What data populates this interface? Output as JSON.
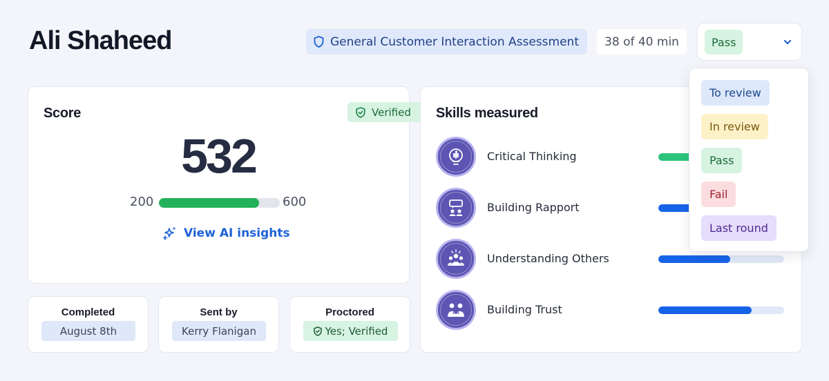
{
  "candidate": {
    "name": "Ali Shaheed"
  },
  "header": {
    "assessment_name": "General Customer Interaction Assessment",
    "assessment_icon": "shield-icon",
    "time_used": "38 of 40 min",
    "status_value": "Pass",
    "status_chevron_icon": "chevron-down-icon"
  },
  "status_menu": {
    "options": [
      {
        "label": "To review",
        "bg": "#dde8fb",
        "fg": "#1e4a8f"
      },
      {
        "label": "In review",
        "bg": "#fdf1c8",
        "fg": "#7a5a0c"
      },
      {
        "label": "Pass",
        "bg": "#d6f4e1",
        "fg": "#1e6a3b"
      },
      {
        "label": "Fail",
        "bg": "#fbdde0",
        "fg": "#9d2431"
      },
      {
        "label": "Last round",
        "bg": "#e6dcfb",
        "fg": "#4d2a91"
      }
    ]
  },
  "score_card": {
    "title": "Score",
    "verified_label": "Verified",
    "score": "532",
    "range_min": "200",
    "range_max": "600",
    "score_fraction": 0.83,
    "ai_insights_label": "View AI insights"
  },
  "info_cards": {
    "completed": {
      "label": "Completed",
      "value": "August 8th"
    },
    "sent_by": {
      "label": "Sent by",
      "value": "Kerry Flanigan"
    },
    "proctored": {
      "label": "Proctored",
      "value": "Yes; Verified"
    }
  },
  "skills": {
    "title": "Skills measured",
    "items": [
      {
        "name": "Critical Thinking",
        "level": 0.45,
        "color": "#2cc47a",
        "icon": "lightbulb-puzzle-icon"
      },
      {
        "name": "Building Rapport",
        "level": 0.45,
        "color": "#1763e8",
        "icon": "chat-people-icon"
      },
      {
        "name": "Understanding Others",
        "level": 0.57,
        "color": "#1763e8",
        "icon": "group-icon"
      },
      {
        "name": "Building Trust",
        "level": 0.74,
        "color": "#1763e8",
        "icon": "handshake-people-icon"
      }
    ]
  },
  "colors": {
    "accent": "#1e63d6",
    "score_bar": "#23b15b",
    "verified_green": "#1d6a3a",
    "skill_icon_bg": "#5c55b3"
  }
}
